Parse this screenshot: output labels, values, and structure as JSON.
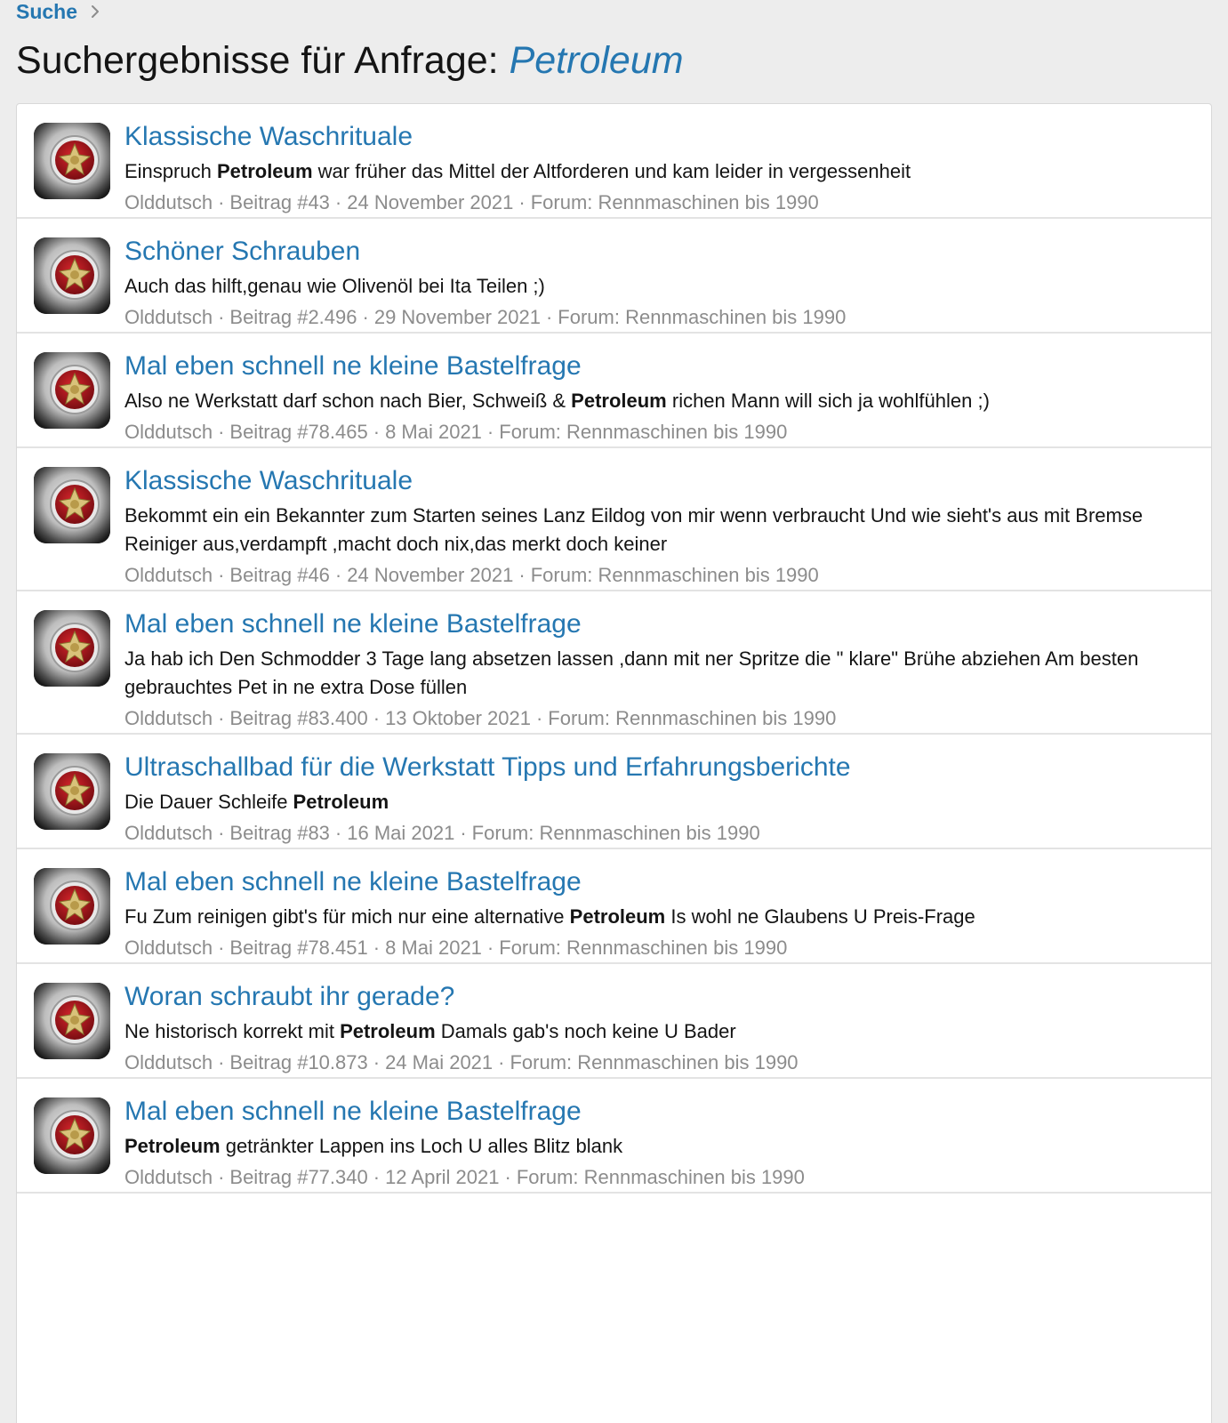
{
  "breadcrumb": {
    "label": "Suche"
  },
  "page_title": {
    "prefix": "Suchergebnisse für Anfrage:",
    "query": "Petroleum"
  },
  "results": [
    {
      "title": "Klassische Waschrituale",
      "snippet": [
        {
          "text": "Einspruch ",
          "bold": false
        },
        {
          "text": "Petroleum",
          "bold": true
        },
        {
          "text": " war früher das Mittel der Altforderen und kam leider in vergessenheit",
          "bold": false
        }
      ],
      "author": "Olddutsch",
      "post": "Beitrag #43",
      "date": "24 November 2021",
      "forum": "Forum: Rennmaschinen bis 1990"
    },
    {
      "title": "Schöner Schrauben",
      "snippet": [
        {
          "text": "Auch das hilft,genau wie Olivenöl bei Ita Teilen ;)",
          "bold": false
        }
      ],
      "author": "Olddutsch",
      "post": "Beitrag #2.496",
      "date": "29 November 2021",
      "forum": "Forum: Rennmaschinen bis 1990"
    },
    {
      "title": "Mal eben schnell ne kleine Bastelfrage",
      "snippet": [
        {
          "text": "Also ne Werkstatt darf schon nach Bier, Schweiß & ",
          "bold": false
        },
        {
          "text": "Petroleum",
          "bold": true
        },
        {
          "text": " richen Mann will sich ja wohlfühlen ;)",
          "bold": false
        }
      ],
      "author": "Olddutsch",
      "post": "Beitrag #78.465",
      "date": "8 Mai 2021",
      "forum": "Forum: Rennmaschinen bis 1990"
    },
    {
      "title": "Klassische Waschrituale",
      "snippet": [
        {
          "text": "Bekommt ein ein Bekannter zum Starten seines Lanz Eildog von mir wenn verbraucht Und wie sieht's aus mit Bremse Reiniger aus,verdampft ,macht doch nix,das merkt doch keiner",
          "bold": false
        }
      ],
      "author": "Olddutsch",
      "post": "Beitrag #46",
      "date": "24 November 2021",
      "forum": "Forum: Rennmaschinen bis 1990"
    },
    {
      "title": "Mal eben schnell ne kleine Bastelfrage",
      "snippet": [
        {
          "text": "Ja hab ich Den Schmodder 3 Tage lang absetzen lassen ,dann mit ner Spritze die \" klare\" Brühe abziehen Am besten gebrauchtes Pet in ne extra Dose füllen",
          "bold": false
        }
      ],
      "author": "Olddutsch",
      "post": "Beitrag #83.400",
      "date": "13 Oktober 2021",
      "forum": "Forum: Rennmaschinen bis 1990"
    },
    {
      "title": "Ultraschallbad für die Werkstatt Tipps und Erfahrungsberichte",
      "snippet": [
        {
          "text": "Die Dauer Schleife ",
          "bold": false
        },
        {
          "text": "Petroleum",
          "bold": true
        }
      ],
      "author": "Olddutsch",
      "post": "Beitrag #83",
      "date": "16 Mai 2021",
      "forum": "Forum: Rennmaschinen bis 1990"
    },
    {
      "title": "Mal eben schnell ne kleine Bastelfrage",
      "snippet": [
        {
          "text": "Fu Zum reinigen gibt's für mich nur eine alternative ",
          "bold": false
        },
        {
          "text": "Petroleum",
          "bold": true
        },
        {
          "text": " Is wohl ne Glaubens U Preis-Frage",
          "bold": false
        }
      ],
      "author": "Olddutsch",
      "post": "Beitrag #78.451",
      "date": "8 Mai 2021",
      "forum": "Forum: Rennmaschinen bis 1990"
    },
    {
      "title": "Woran schraubt ihr gerade?",
      "snippet": [
        {
          "text": "Ne historisch korrekt mit ",
          "bold": false
        },
        {
          "text": "Petroleum",
          "bold": true
        },
        {
          "text": " Damals gab's noch keine U Bader",
          "bold": false
        }
      ],
      "author": "Olddutsch",
      "post": "Beitrag #10.873",
      "date": "24 Mai 2021",
      "forum": "Forum: Rennmaschinen bis 1990"
    },
    {
      "title": "Mal eben schnell ne kleine Bastelfrage",
      "snippet": [
        {
          "text": "Petroleum",
          "bold": true
        },
        {
          "text": " getränkter Lappen ins Loch U alles Blitz blank",
          "bold": false
        }
      ],
      "author": "Olddutsch",
      "post": "Beitrag #77.340",
      "date": "12 April 2021",
      "forum": "Forum: Rennmaschinen bis 1990"
    }
  ],
  "meta_separator": "·",
  "colors": {
    "link": "#2577b1",
    "meta": "#8c8c8c",
    "background": "#ededed"
  }
}
